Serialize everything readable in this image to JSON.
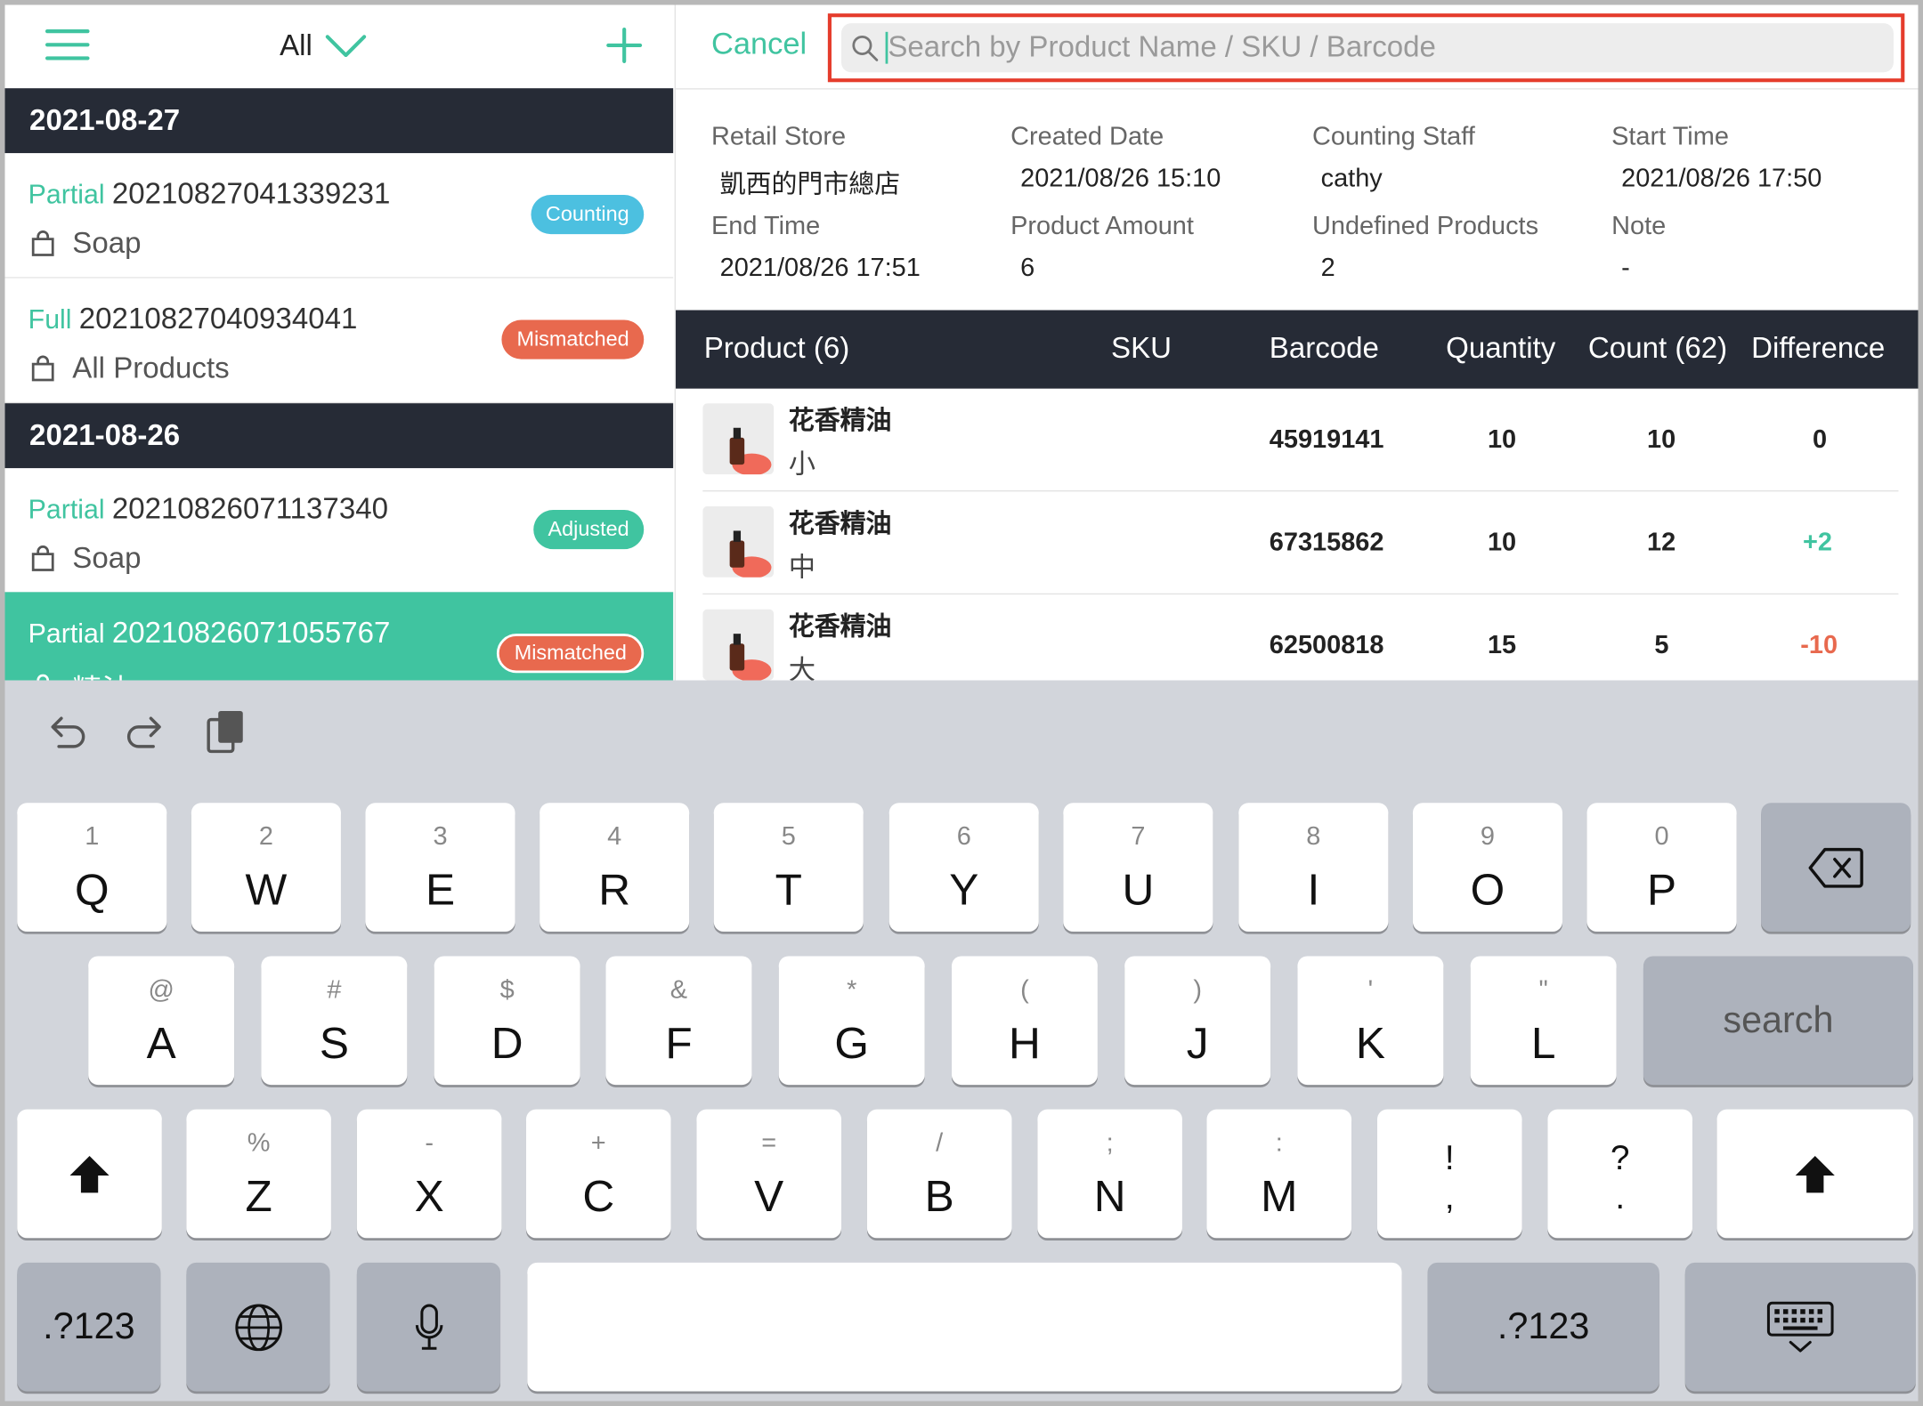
{
  "left_panel": {
    "filter_label": "All",
    "groups": [
      {
        "date": "2021-08-27",
        "orders": [
          {
            "type": "Partial",
            "id": "20210827041339231",
            "scope": "Soap",
            "status": "Counting",
            "status_color": "#4cc0e0"
          },
          {
            "type": "Full",
            "id": "20210827040934041",
            "scope": "All Products",
            "status": "Mismatched",
            "status_color": "#e8694e"
          }
        ]
      },
      {
        "date": "2021-08-26",
        "orders": [
          {
            "type": "Partial",
            "id": "20210826071137340",
            "scope": "Soap",
            "status": "Adjusted",
            "status_color": "#40c4a0"
          },
          {
            "type": "Partial",
            "id": "20210826071055767",
            "scope": "精油",
            "status": "Mismatched",
            "status_color": "#e8694e"
          }
        ]
      }
    ]
  },
  "right_panel": {
    "cancel_label": "Cancel",
    "search": {
      "value": "",
      "placeholder": "Search by Product Name / SKU / Barcode"
    },
    "info": {
      "retail_store_label": "Retail Store",
      "retail_store": "凱西的門市總店",
      "created_date_label": "Created Date",
      "created_date": "2021/08/26 15:10",
      "counting_staff_label": "Counting Staff",
      "counting_staff": "cathy",
      "start_time_label": "Start Time",
      "start_time": "2021/08/26 17:50",
      "end_time_label": "End Time",
      "end_time": "2021/08/26 17:51",
      "product_amount_label": "Product Amount",
      "product_amount": "6",
      "undefined_products_label": "Undefined Products",
      "undefined_products": "2",
      "note_label": "Note",
      "note": "-"
    },
    "table": {
      "headers": {
        "product": "Product (6)",
        "sku": "SKU",
        "barcode": "Barcode",
        "quantity": "Quantity",
        "count": "Count (62)",
        "difference": "Difference"
      },
      "rows": [
        {
          "name": "花香精油",
          "variant": "小",
          "barcode": "45919141",
          "quantity": "10",
          "count": "10",
          "difference": "0"
        },
        {
          "name": "花香精油",
          "variant": "中",
          "barcode": "67315862",
          "quantity": "10",
          "count": "12",
          "difference": "+2"
        },
        {
          "name": "花香精油",
          "variant": "大",
          "barcode": "62500818",
          "quantity": "15",
          "count": "5",
          "difference": "-10"
        }
      ]
    }
  },
  "keyboard": {
    "row1": [
      {
        "num": "1",
        "letter": "Q"
      },
      {
        "num": "2",
        "letter": "W"
      },
      {
        "num": "3",
        "letter": "E"
      },
      {
        "num": "4",
        "letter": "R"
      },
      {
        "num": "5",
        "letter": "T"
      },
      {
        "num": "6",
        "letter": "Y"
      },
      {
        "num": "7",
        "letter": "U"
      },
      {
        "num": "8",
        "letter": "I"
      },
      {
        "num": "9",
        "letter": "O"
      },
      {
        "num": "0",
        "letter": "P"
      }
    ],
    "row2": [
      {
        "num": "@",
        "letter": "A"
      },
      {
        "num": "#",
        "letter": "S"
      },
      {
        "num": "$",
        "letter": "D"
      },
      {
        "num": "&",
        "letter": "F"
      },
      {
        "num": "*",
        "letter": "G"
      },
      {
        "num": "(",
        "letter": "H"
      },
      {
        "num": ")",
        "letter": "J"
      },
      {
        "num": "'",
        "letter": "K"
      },
      {
        "num": "\"",
        "letter": "L"
      }
    ],
    "row3": [
      {
        "num": "%",
        "letter": "Z"
      },
      {
        "num": "-",
        "letter": "X"
      },
      {
        "num": "+",
        "letter": "C"
      },
      {
        "num": "=",
        "letter": "V"
      },
      {
        "num": "/",
        "letter": "B"
      },
      {
        "num": ";",
        "letter": "N"
      },
      {
        "num": ":",
        "letter": "M"
      }
    ],
    "row3_punct": [
      {
        "top": "!",
        "bottom": ","
      },
      {
        "top": "?",
        "bottom": "."
      }
    ],
    "search_label": "search",
    "numbers_label": ".?123"
  },
  "colors": {
    "accent": "#40c4a0",
    "header_dark": "#262b36",
    "search_highlight": "#e53c2c"
  }
}
